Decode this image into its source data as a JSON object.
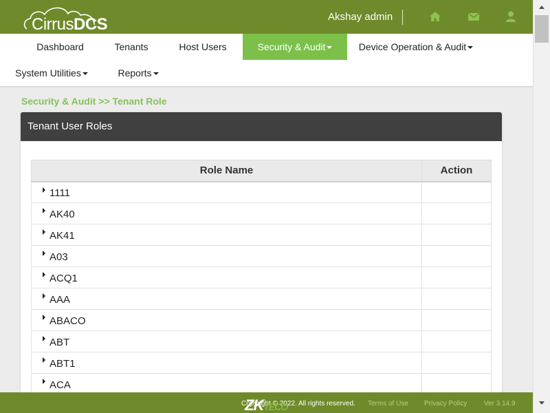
{
  "header": {
    "logo_prefix": "Cirrus",
    "logo_suffix": "DCS",
    "user_name": "Akshay admin",
    "icons": [
      "home-icon",
      "mail-icon",
      "user-icon"
    ]
  },
  "nav": {
    "items": [
      {
        "label": "Dashboard"
      },
      {
        "label": "Tenants"
      },
      {
        "label": "Host Users"
      },
      {
        "label": "Security & Audit",
        "active": true,
        "dropdown": true
      },
      {
        "label": "Device Operation & Audit",
        "dropdown": true
      },
      {
        "label": "System Utilities",
        "dropdown": true
      },
      {
        "label": "Reports",
        "dropdown": true
      }
    ]
  },
  "breadcrumb": "Security & Audit >> Tenant Role",
  "panel": {
    "title": "Tenant User Roles",
    "columns": [
      "Role Name",
      "Action"
    ],
    "rows": [
      "1111",
      "AK40",
      "AK41",
      "A03",
      "ACQ1",
      "AAA",
      "ABACO",
      "ABT",
      "ABT1",
      "ACA"
    ]
  },
  "footer": {
    "copyright": "Copyright © 2022. All rights reserved.",
    "brand": "ZK",
    "brand_sub": "TECO",
    "terms": "Terms of Use",
    "privacy": "Privacy Policy",
    "version": "Ver 3.14.9"
  },
  "colors": {
    "brand_green": "#6f8a2a",
    "active_tab": "#7cc04a",
    "breadcrumb": "#86c15a",
    "panel_header": "#404040"
  }
}
